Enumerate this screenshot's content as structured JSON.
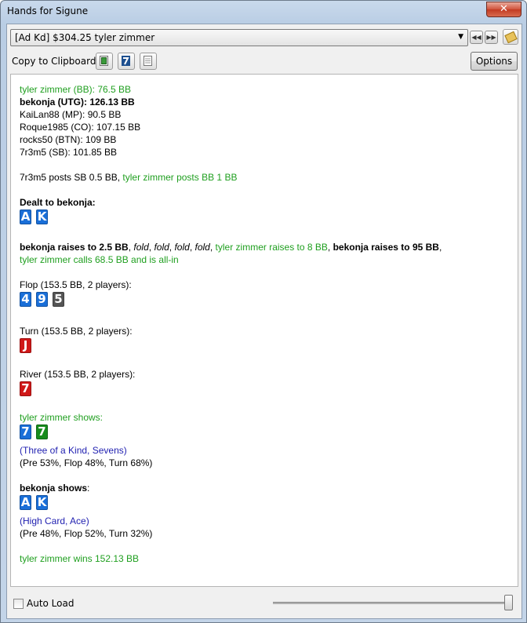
{
  "window": {
    "title": "Hands for Sigune",
    "close_glyph": "✕"
  },
  "toolbar": {
    "hand_select_value": "[Ad Kd] $304.25 tyler zimmer",
    "copy_label": "Copy to Clipboard:",
    "options_label": "Options",
    "icons": [
      "prev-icon",
      "next-icon",
      "tag-icon",
      "copy-forum-icon",
      "copy-twoplustwo-icon",
      "copy-text-icon"
    ]
  },
  "hand": {
    "seats": {
      "s0": "tyler zimmer (BB): 76.5 BB",
      "s1": "bekonja (UTG): 126.13 BB",
      "s2": "KaiLan88 (MP): 90.5 BB",
      "s3": "Roque1985 (CO): 107.15 BB",
      "s4": "rocks50 (BTN): 109 BB",
      "s5": "7r3m5 (SB): 101.85 BB"
    },
    "blinds": {
      "sb": "7r3m5 posts SB 0.5 BB",
      "sep": ", ",
      "bb": "tyler zimmer posts BB 1 BB"
    },
    "dealt": {
      "label": "Dealt to bekonja:",
      "cards": [
        "A",
        "K"
      ]
    },
    "preflop": {
      "a1": "bekonja raises to 2.5 BB",
      "c1": ", ",
      "f1": "fold",
      "c2": ", ",
      "f2": "fold",
      "c3": ", ",
      "f3": "fold",
      "c4": ", ",
      "f4": "fold",
      "c5": ", ",
      "a2": "tyler zimmer raises to 8 BB",
      "c6": ", ",
      "a3": "bekonja raises to 95 BB",
      "c7": ",",
      "a4": "tyler zimmer calls 68.5 BB and is all-in"
    },
    "flop": {
      "label": "Flop (153.5 BB, 2 players):",
      "cards": [
        "4",
        "9",
        "5"
      ]
    },
    "turn": {
      "label": "Turn (153.5 BB, 2 players):",
      "cards": [
        "J"
      ]
    },
    "river": {
      "label": "River (153.5 BB, 2 players):",
      "cards": [
        "7"
      ]
    },
    "showdown1": {
      "label": "tyler zimmer shows:",
      "cards": [
        "7",
        "7"
      ],
      "rank": "(Three of a Kind, Sevens)",
      "equity": "(Pre 53%, Flop 48%, Turn 68%)"
    },
    "showdown2": {
      "name": "bekonja shows",
      "colon": ":",
      "cards": [
        "A",
        "K"
      ],
      "rank": "(High Card, Ace)",
      "equity": "(Pre 48%, Flop 52%, Turn 32%)"
    },
    "result": "tyler zimmer wins 152.13 BB"
  },
  "footer": {
    "autoload_label": "Auto Load",
    "autoload_checked": false,
    "slider_value": 1.0
  },
  "colors": {
    "player_green": "#1f9f1f",
    "hand_rank_blue": "#1f1fb0",
    "suit_spade": "#555555",
    "suit_heart": "#d01818",
    "suit_diamond": "#1a6fd8",
    "suit_club": "#178c1c"
  }
}
